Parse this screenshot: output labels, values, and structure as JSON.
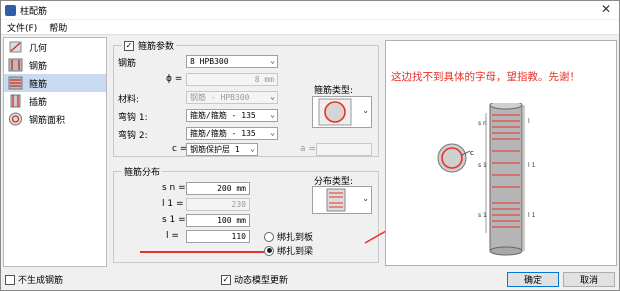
{
  "window": {
    "title": "柱配筋",
    "close": "✕"
  },
  "menu": {
    "file": "文件(F)",
    "help": "帮助"
  },
  "nav": {
    "items": [
      {
        "label": "几何",
        "icon": "geometry-icon"
      },
      {
        "label": "钢筋",
        "icon": "rebar-icon"
      },
      {
        "label": "箍筋",
        "icon": "stirrup-icon",
        "selected": true
      },
      {
        "label": "插筋",
        "icon": "dowel-icon"
      },
      {
        "label": "钢筋面积",
        "icon": "rebar-area-icon"
      }
    ]
  },
  "params": {
    "title": "箍筋参数",
    "checked": true,
    "rebar_label": "钢筋",
    "rebar_value": "8 HPB300",
    "phi_label": "ϕ =",
    "phi_value": "8 mm",
    "material_label": "材料:",
    "material_value": "钢筋 - HPB300",
    "hook1_label": "弯钩 1:",
    "hook1_value": "箍筋/箍筋 - 135",
    "hook2_label": "弯钩 2:",
    "hook2_value": "箍筋/箍筋 - 135",
    "c_label": "c =",
    "c_value": "钢筋保护层 1",
    "a_label": "a =",
    "type_label": "箍筋类型:"
  },
  "dist": {
    "title": "箍筋分布",
    "sn_label": "s n =",
    "sn_value": "200 mm",
    "l1_label": "l 1 =",
    "l1_value": "230",
    "s1_label": "s 1 =",
    "s1_value": "100 mm",
    "l_label": "l =",
    "l_value": "110",
    "type_label": "分布类型:",
    "radio_board": "绑扎到板",
    "radio_beam": "绑扎到梁",
    "radio_selected": "beam"
  },
  "preview": {
    "note": "这边找不到具体的字母，望指教。先谢！",
    "c_mark": "c",
    "dim_labels": [
      "s n",
      "l",
      "s 1",
      "l 1",
      "s 1",
      "l 1"
    ],
    "accent": "#e8322a"
  },
  "footer": {
    "no_rebar": "不生成钢筋",
    "dynamic": "动态模型更新",
    "dynamic_checked": true,
    "ok": "确定",
    "cancel": "取消"
  }
}
